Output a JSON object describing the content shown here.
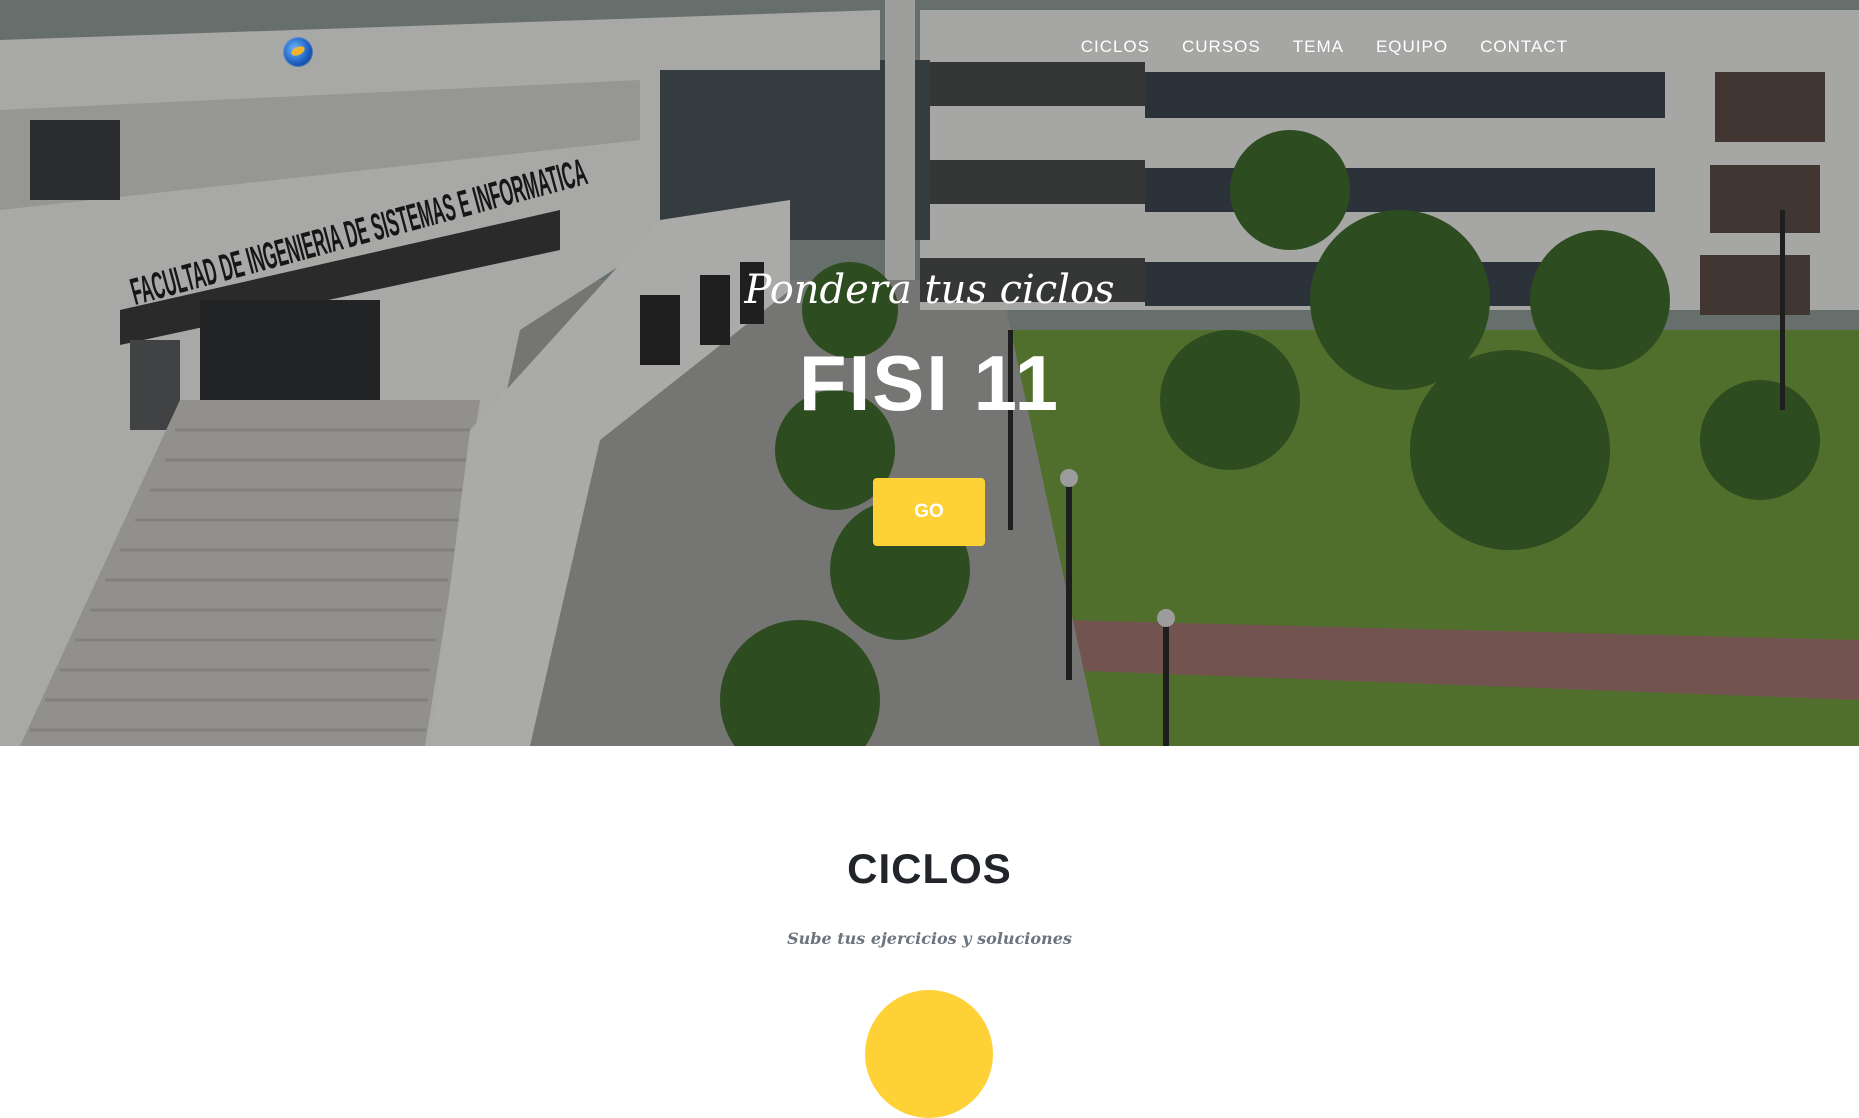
{
  "navbar": {
    "logo_icon": "globe-logo-icon",
    "links": [
      "CICLOS",
      "CURSOS",
      "TEMA",
      "EQUIPO",
      "CONTACT"
    ]
  },
  "hero": {
    "building_sign": "FACULTAD DE INGENIERIA DE SISTEMAS E INFORMATICA",
    "subtitle": "Pondera tus ciclos",
    "title": "FISI 11",
    "button_label": "GO"
  },
  "ciclos_section": {
    "heading": "CICLOS",
    "subheading": "Sube tus ejercicios y soluciones",
    "icon": "circle-icon"
  },
  "colors": {
    "accent": "#fed136",
    "heading": "#212529",
    "muted": "#6c757d"
  }
}
